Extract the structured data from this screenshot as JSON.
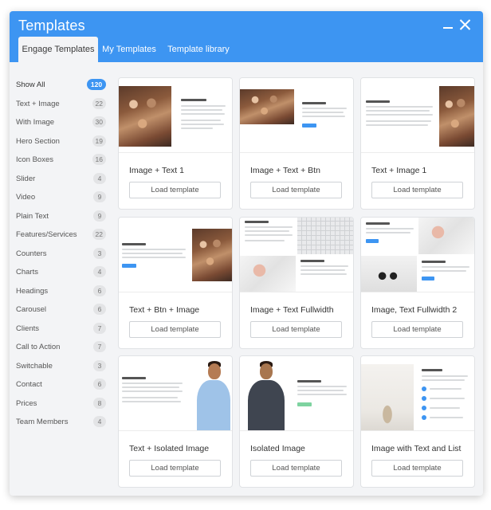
{
  "window": {
    "title": "Templates",
    "accent_color": "#3d95f2"
  },
  "tabs": [
    {
      "label": "Engage Templates",
      "active": true
    },
    {
      "label": "My Templates",
      "active": false
    },
    {
      "label": "Template library",
      "active": false
    }
  ],
  "sidebar": {
    "items": [
      {
        "label": "Show All",
        "count": "120",
        "active": true
      },
      {
        "label": "Text + Image",
        "count": "22"
      },
      {
        "label": "With Image",
        "count": "30"
      },
      {
        "label": "Hero Section",
        "count": "19"
      },
      {
        "label": "Icon Boxes",
        "count": "16"
      },
      {
        "label": "Slider",
        "count": "4"
      },
      {
        "label": "Video",
        "count": "9"
      },
      {
        "label": "Plain Text",
        "count": "9"
      },
      {
        "label": "Features/Services",
        "count": "22"
      },
      {
        "label": "Counters",
        "count": "3"
      },
      {
        "label": "Charts",
        "count": "4"
      },
      {
        "label": "Headings",
        "count": "6"
      },
      {
        "label": "Carousel",
        "count": "6"
      },
      {
        "label": "Clients",
        "count": "7"
      },
      {
        "label": "Call to Action",
        "count": "7"
      },
      {
        "label": "Switchable",
        "count": "3"
      },
      {
        "label": "Contact",
        "count": "6"
      },
      {
        "label": "Prices",
        "count": "8"
      },
      {
        "label": "Team Members",
        "count": "4"
      }
    ]
  },
  "templates": [
    {
      "name": "Image + Text 1",
      "button": "Load template",
      "preview_heading": "Learn about us"
    },
    {
      "name": "Image + Text + Btn",
      "button": "Load template",
      "preview_heading": "Learn about us"
    },
    {
      "name": "Text + Image 1",
      "button": "Load template",
      "preview_heading": "Learn about us"
    },
    {
      "name": "Text + Btn + Image",
      "button": "Load template",
      "preview_heading": "Learn about us"
    },
    {
      "name": "Image + Text Fullwidth",
      "button": "Load template",
      "preview_heading": "Learn about us"
    },
    {
      "name": "Image, Text Fullwidth 2",
      "button": "Load template",
      "preview_heading": "Learn about us"
    },
    {
      "name": "Text + Isolated Image",
      "button": "Load template",
      "preview_heading": "Learn about us"
    },
    {
      "name": "Isolated Image",
      "button": "Load template",
      "preview_heading": "Learn about us"
    },
    {
      "name": "Image with Text and List",
      "button": "Load template",
      "preview_heading": "Who we are?"
    }
  ]
}
